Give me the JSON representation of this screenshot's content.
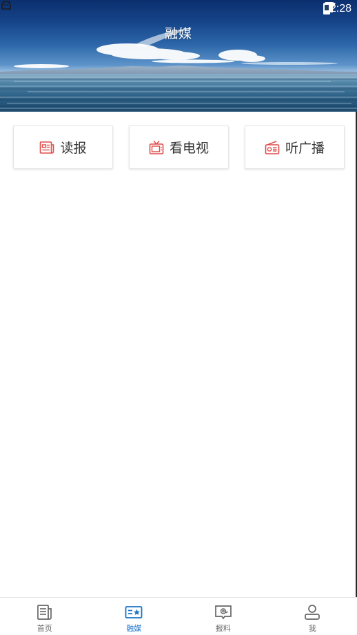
{
  "status_bar": {
    "time": "12:28",
    "left_icon": "android-debug-icon",
    "icons": [
      "wifi-icon",
      "signal-icon",
      "battery-icon"
    ]
  },
  "header": {
    "title": "融媒"
  },
  "categories": [
    {
      "label": "读报",
      "icon": "newspaper-icon"
    },
    {
      "label": "看电视",
      "icon": "tv-icon"
    },
    {
      "label": "听广播",
      "icon": "radio-icon"
    }
  ],
  "bottom_nav": {
    "items": [
      {
        "label": "首页",
        "icon": "home-news-icon"
      },
      {
        "label": "融媒",
        "icon": "media-card-icon"
      },
      {
        "label": "报料",
        "icon": "report-icon"
      },
      {
        "label": "我",
        "icon": "user-icon"
      }
    ],
    "active_index": 1
  },
  "colors": {
    "accent": "#1a73c8",
    "category_icon": "#e24a4a",
    "nav_inactive": "#666666"
  }
}
